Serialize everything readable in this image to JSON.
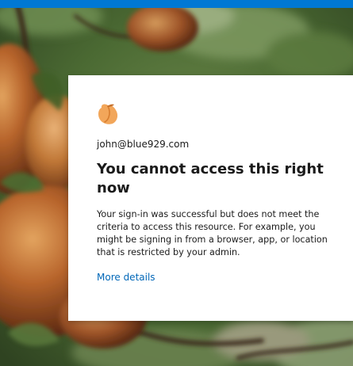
{
  "window": {
    "accent_bar_color": "#0078d4"
  },
  "background": {
    "description_icon": "peach-tree-photo"
  },
  "card": {
    "logo_icon": "peach-logo-icon",
    "account_email": "john@blue929.com",
    "title": "You cannot access this right now",
    "description": "Your sign-in was successful but does not meet the criteria to access this resource. For example, you might be signing in from a browser, app, or location that is restricted by your admin.",
    "more_details_link": "More details",
    "link_color": "#0067b8"
  }
}
